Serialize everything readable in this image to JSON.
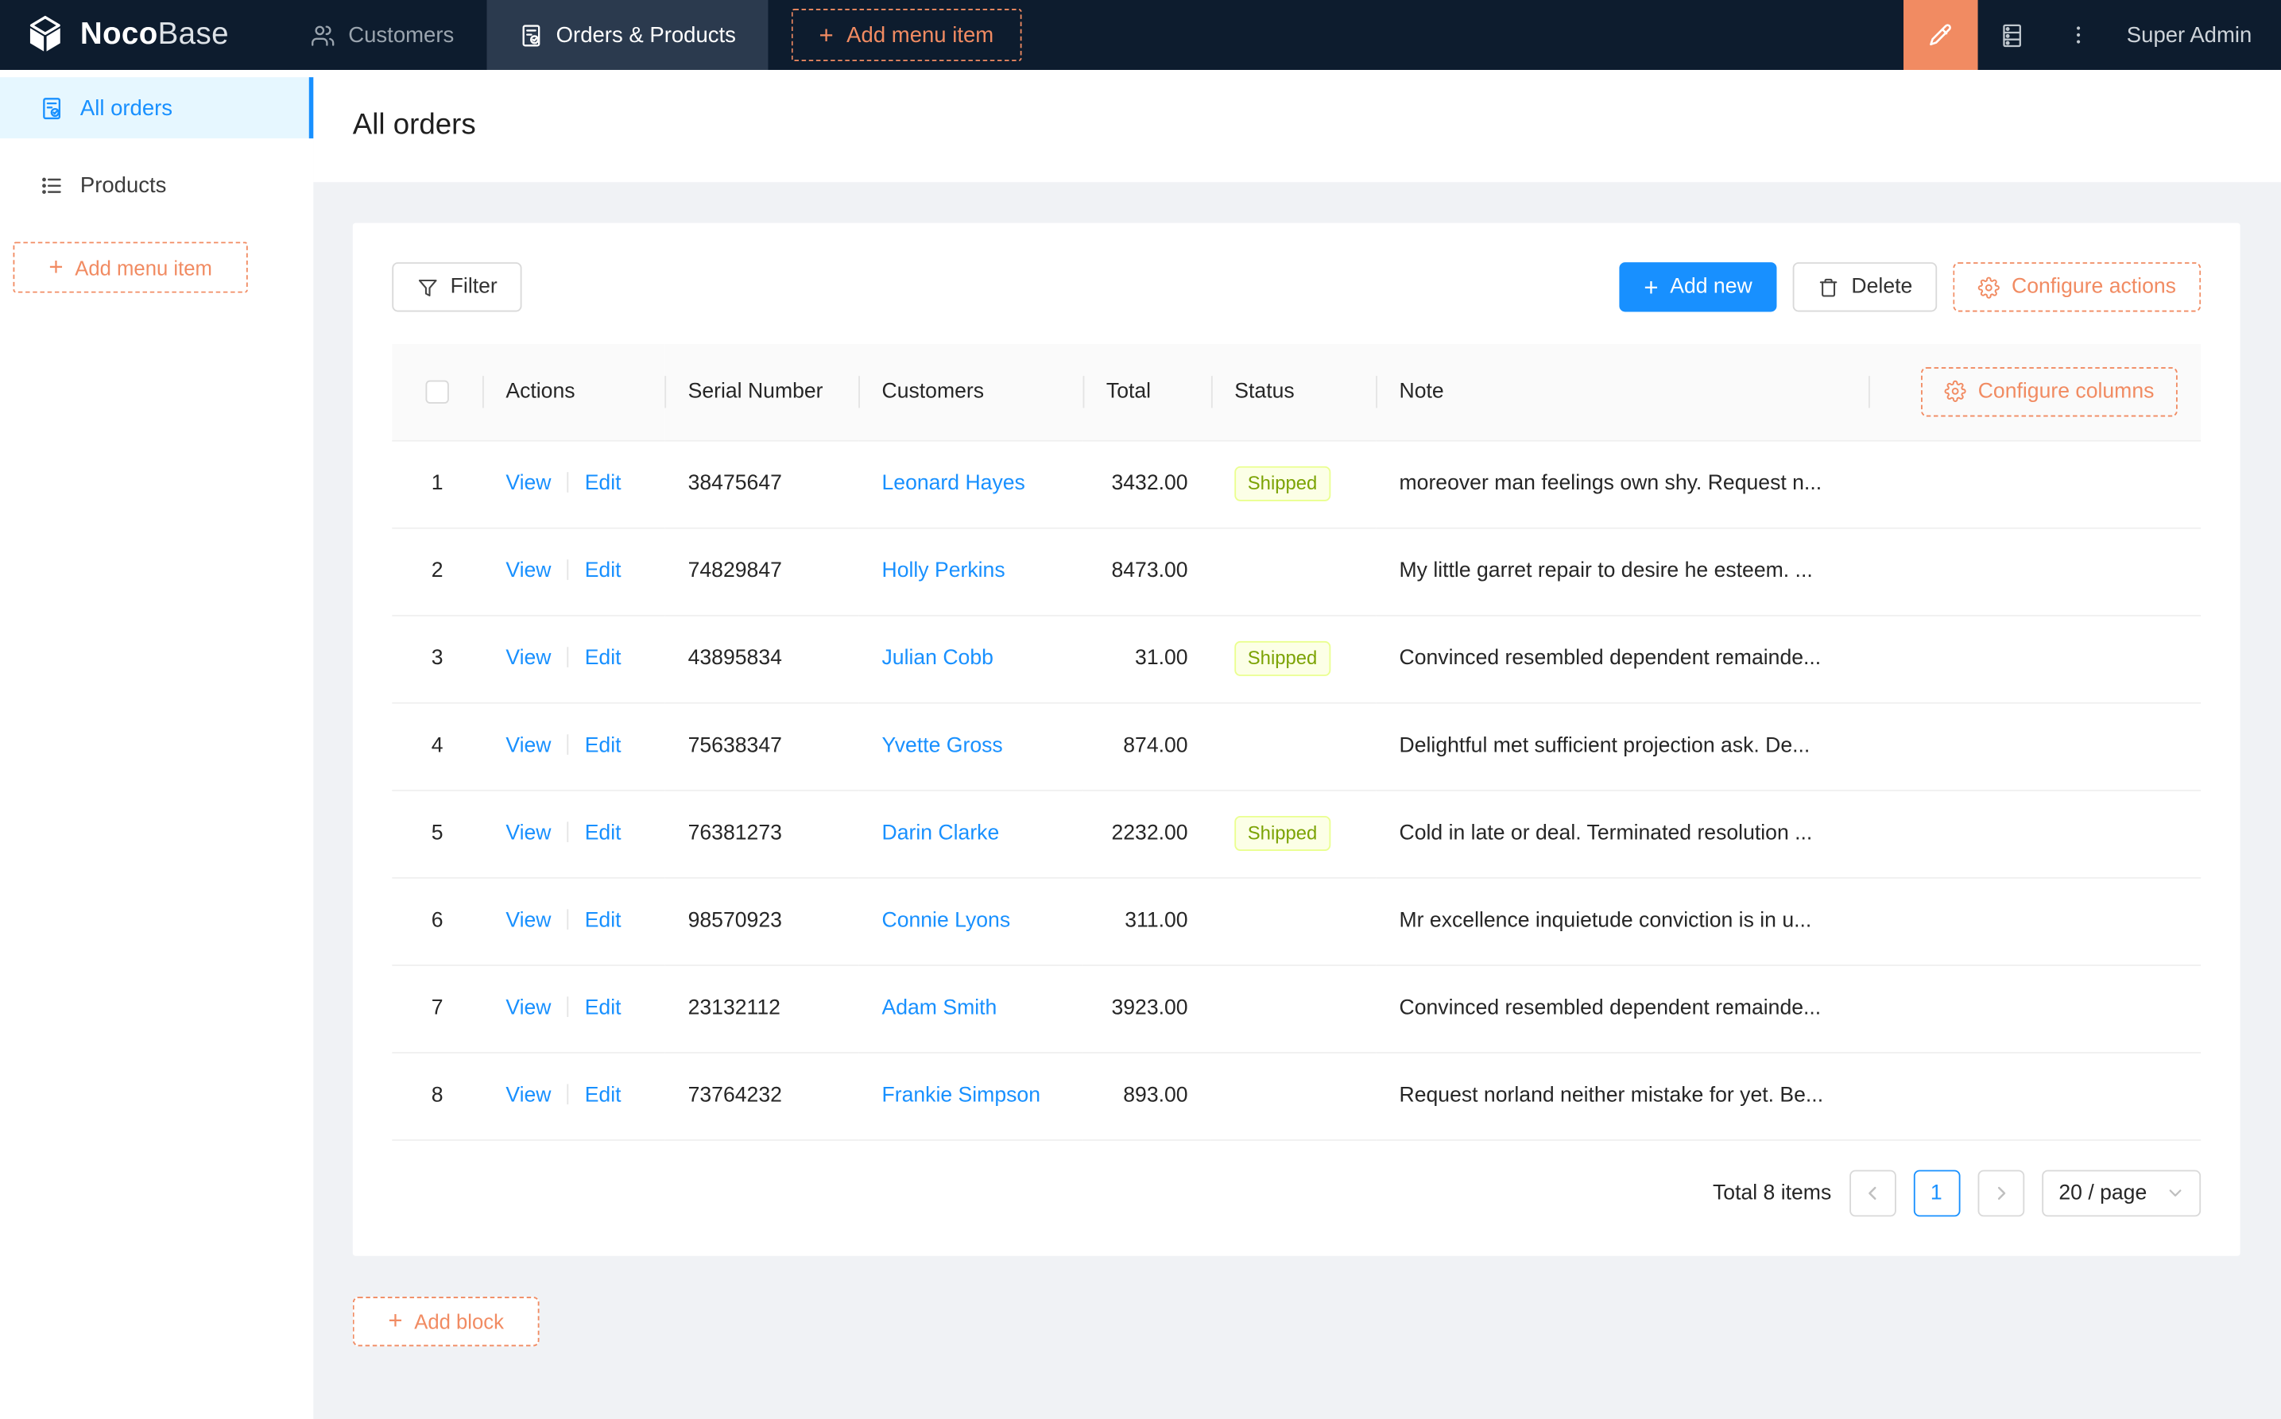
{
  "topbar": {
    "logo_bold": "Noco",
    "logo_light": "Base",
    "tabs": [
      {
        "label": "Customers"
      },
      {
        "label": "Orders & Products"
      }
    ],
    "add_menu_item_label": "Add menu item",
    "user_label": "Super Admin"
  },
  "sidebar": {
    "items": [
      {
        "label": "All orders"
      },
      {
        "label": "Products"
      }
    ],
    "add_menu_item_label": "Add menu item"
  },
  "page": {
    "title": "All orders"
  },
  "toolbar": {
    "filter_label": "Filter",
    "add_new_label": "Add new",
    "delete_label": "Delete",
    "configure_actions_label": "Configure actions"
  },
  "table": {
    "configure_columns_label": "Configure columns",
    "columns": [
      "Actions",
      "Serial Number",
      "Customers",
      "Total",
      "Status",
      "Note"
    ],
    "actions": {
      "view": "View",
      "edit": "Edit"
    },
    "rows": [
      {
        "index": "1",
        "serial": "38475647",
        "customer": "Leonard Hayes",
        "total": "3432.00",
        "status": "Shipped",
        "note": "moreover man feelings own shy. Request n..."
      },
      {
        "index": "2",
        "serial": "74829847",
        "customer": "Holly Perkins",
        "total": "8473.00",
        "status": "",
        "note": "My little garret repair to desire he esteem. ..."
      },
      {
        "index": "3",
        "serial": "43895834",
        "customer": "Julian Cobb",
        "total": "31.00",
        "status": "Shipped",
        "note": "Convinced resembled dependent remainde..."
      },
      {
        "index": "4",
        "serial": "75638347",
        "customer": "Yvette Gross",
        "total": "874.00",
        "status": "",
        "note": "Delightful met sufficient projection ask. De..."
      },
      {
        "index": "5",
        "serial": "76381273",
        "customer": "Darin Clarke",
        "total": "2232.00",
        "status": "Shipped",
        "note": "Cold in late or deal. Terminated resolution ..."
      },
      {
        "index": "6",
        "serial": "98570923",
        "customer": "Connie Lyons",
        "total": "311.00",
        "status": "",
        "note": "Mr excellence inquietude conviction is in u..."
      },
      {
        "index": "7",
        "serial": "23132112",
        "customer": "Adam Smith",
        "total": "3923.00",
        "status": "",
        "note": "Convinced resembled dependent remainde..."
      },
      {
        "index": "8",
        "serial": "73764232",
        "customer": "Frankie Simpson",
        "total": "893.00",
        "status": "",
        "note": "Request norland neither mistake for yet. Be..."
      }
    ]
  },
  "pagination": {
    "total_label": "Total 8 items",
    "current_page": "1",
    "page_size_label": "20 / page"
  },
  "add_block_label": "Add block",
  "colors": {
    "accent_orange": "#F18B62",
    "primary_blue": "#1890ff",
    "topbar_background": "#0d1c2e",
    "status_shipped_bg": "#fcffe6",
    "status_shipped_border": "#eaff8f",
    "status_shipped_text": "#7ca305"
  }
}
